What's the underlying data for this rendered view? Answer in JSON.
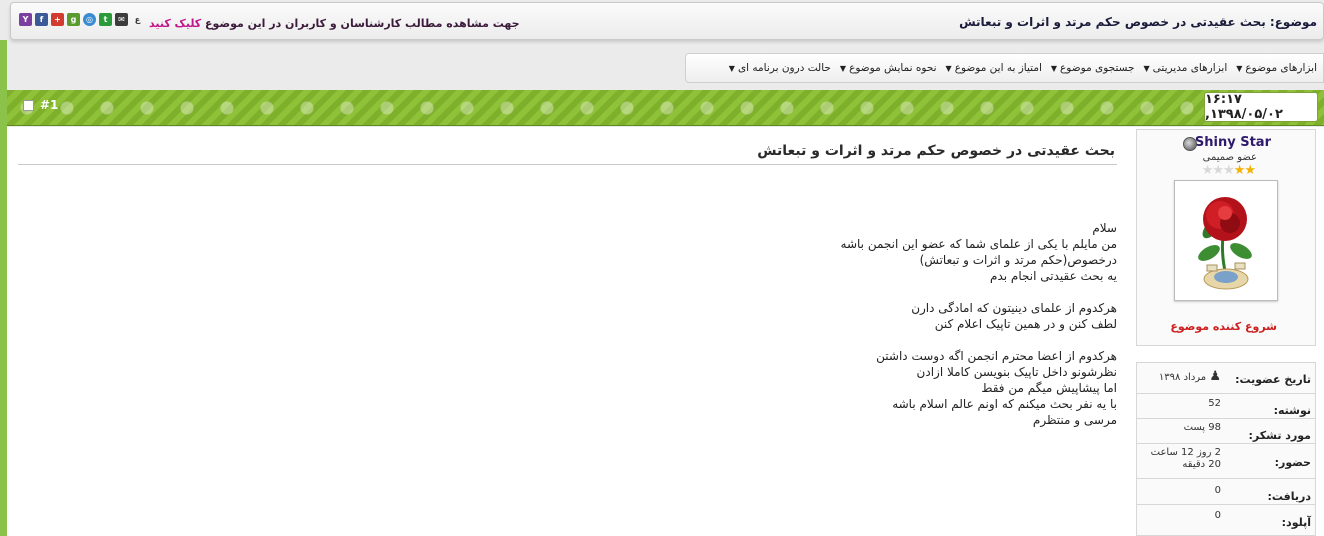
{
  "header": {
    "topic_title": "موضوع: بحث عقیدتی در خصوص حکم مرتد و اثرات و تبعاتش",
    "notice_text": "جهت مشاهده مطالب کارشناسان و کاربران در این موضوع",
    "notice_click": "کلیک کنید"
  },
  "share_icons": [
    "yahoo-icon",
    "facebook-icon",
    "add-icon",
    "google-icon",
    "link-icon",
    "twitter-icon",
    "mail-icon",
    "tag-icon"
  ],
  "toolbar": {
    "items": [
      "ابزارهای موضوع",
      "ابزارهای مدیریتی",
      "جستجوی موضوع",
      "امتیاز به این موضوع",
      "نحوه نمایش موضوع",
      "حالت درون برنامه ای"
    ]
  },
  "post": {
    "date": "۱۶:۱۷ ,۱۳۹۸/۰۵/۰۲",
    "number": "#1",
    "title": "بحث عقیدتی در خصوص حکم مرتد و اثرات و تبعاتش",
    "lines": [
      "سلام",
      "من مایلم با یکی از علمای شما که عضو این انجمن باشه",
      "درخصوص(حکم مرتد و اثرات و تبعاتش)",
      "یه بحث عقیدتی انجام بدم",
      "",
      "هرکدوم از علمای دینیتون که امادگی دارن",
      "لطف کنن و در همین تاپیک اعلام کنن",
      "",
      "هرکدوم از اعضا محترم انجمن اگه دوست داشتن",
      "نظرشونو داخل تاپیک بنویسن کاملا ازادن",
      "اما پیشاپیش میگم من فقط",
      "با یه نفر بحث میکنم که اونم عالم اسلام باشه",
      "مرسی و منتظرم"
    ]
  },
  "user": {
    "name": "Shiny Star",
    "title": "عضو صمیمی",
    "stars_on": 2,
    "stars_total": 5,
    "starter_label": "شروع کننده موضوع",
    "stats": [
      {
        "label": "تاریخ عضویت:",
        "value": "مرداد ۱۳۹۸"
      },
      {
        "label": "نوشته:",
        "value": "52"
      },
      {
        "label": "مورد تشکر:",
        "value": "98 پست"
      },
      {
        "label": "حضور:",
        "value": "2 روز 12 ساعت",
        "value2": "20 دقیقه"
      },
      {
        "label": "دریافت:",
        "value": "0"
      },
      {
        "label": "آپلود:",
        "value": "0"
      }
    ]
  },
  "colors": {
    "header_green": "#8fc238",
    "starter_red": "#cc1f1f",
    "username_purple": "#2d1a6b",
    "click_pink": "#c0188c"
  }
}
